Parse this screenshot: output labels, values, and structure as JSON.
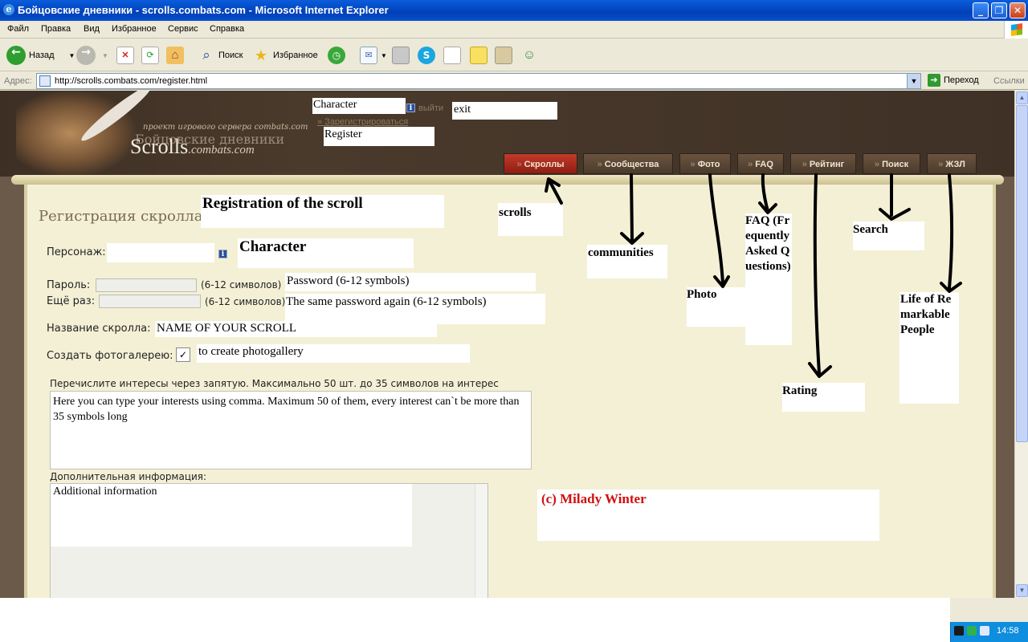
{
  "window": {
    "title": "Бойцовские дневники - scrolls.combats.com - Microsoft Internet Explorer",
    "controls": [
      "_",
      "❐",
      "✕"
    ]
  },
  "menu": [
    "Файл",
    "Правка",
    "Вид",
    "Избранное",
    "Сервис",
    "Справка"
  ],
  "toolbar": {
    "back": "Назад",
    "search": "Поиск",
    "favorites": "Избранное"
  },
  "address": {
    "label": "Адрес:",
    "url": "http://scrolls.combats.com/register.html",
    "go": "Переход",
    "links": "Ссылки"
  },
  "site": {
    "subtitle": "проект игрового сервера combats.com",
    "title_ru": "Бойцовские дневники",
    "logo_main": "Scrolls",
    "logo_suffix": ".combats.com",
    "header_character": "Character",
    "info_glyph": "i",
    "exit_ru": "выйти",
    "exit_en": "exit",
    "register_ru": "» Зарегистрироваться",
    "register_en": "Register",
    "nav": [
      "Скроллы",
      "Сообщества",
      "Фото",
      "FAQ",
      "Рейтинг",
      "Поиск",
      "ЖЗЛ"
    ],
    "nav_prefix": "»"
  },
  "form": {
    "heading_ru": "Регистрация скролла",
    "heading_en": "Registration of the scroll",
    "character_label": "Персонаж:",
    "character_en": "Character",
    "password_label": "Пароль:",
    "password_hint": "(6-12 символов)",
    "password_en": "Password (6-12 symbols)",
    "repeat_label": "Ещё раз:",
    "repeat_hint": "(6-12 символов)",
    "repeat_en": "The same password again (6-12 symbols)",
    "scroll_name_label": "Название скролла:",
    "scroll_name_en": "NAME OF YOUR SCROLL",
    "gallery_label": "Создать фотогалерею:",
    "gallery_check": "✓",
    "gallery_en": "to create  photogallery",
    "interests_hint": "Перечислите интересы через запятую. Максимально 50 шт. до 35 символов на интерес",
    "interests_text": "Here you can type your interests using comma. Maximum 50 of them, every interest can`t be more than 35 symbols long",
    "extra_label": "Дополнительная информация:",
    "extra_text": "Additional information",
    "credit": "(c) Milady Winter"
  },
  "annotations": {
    "scrolls": "scrolls",
    "communities": "communities",
    "photo": "Photo",
    "faq": "FAQ (Frequently Asked Questions)",
    "rating": "Rating",
    "search": "Search",
    "zhzl": "Life of Remarkable People"
  },
  "tray": {
    "time": "14:58"
  },
  "colors": {
    "title_bar": "#0a5ddc",
    "header_bg": "#3d2f24",
    "parchment": "#f4f0d6",
    "nav_active": "#c23a2a",
    "credit": "#d01010"
  }
}
